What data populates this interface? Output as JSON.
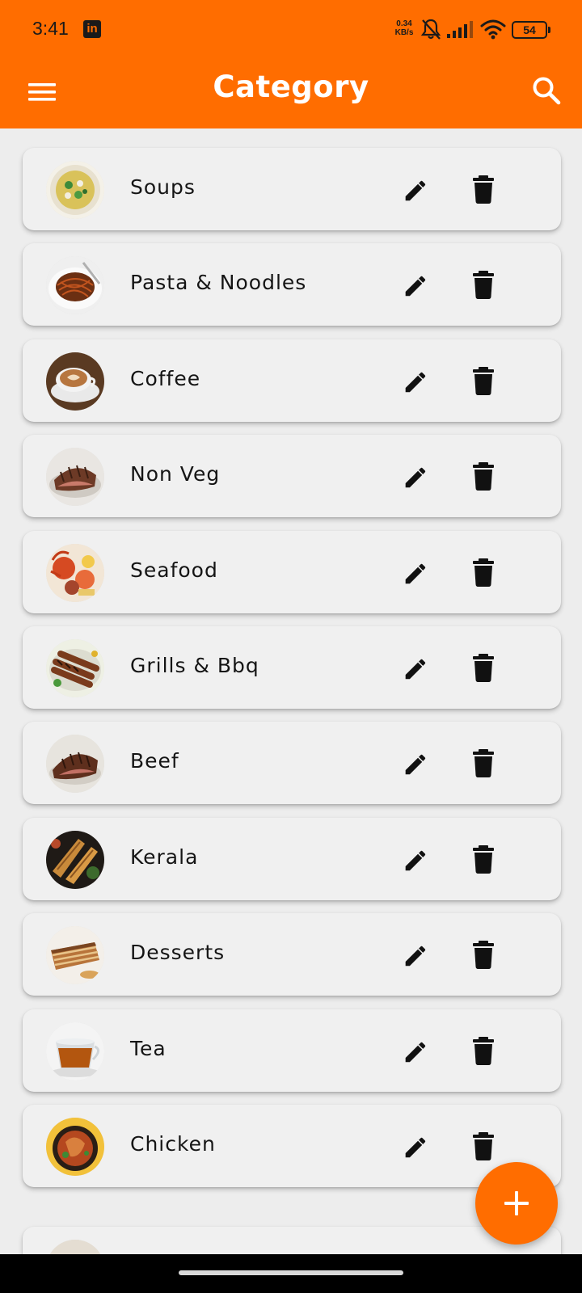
{
  "status_bar": {
    "time": "3:41",
    "notification_icon": "linkedin-icon",
    "net_speed_value": "0.34",
    "net_speed_unit": "KB/s",
    "battery": "54"
  },
  "app_bar": {
    "title": "Category",
    "menu_icon": "menu-icon",
    "search_icon": "search-icon"
  },
  "categories": [
    {
      "label": "Soups",
      "image": "soups-thumbnail"
    },
    {
      "label": "Pasta & Noodles",
      "image": "pasta-thumbnail"
    },
    {
      "label": "Coffee",
      "image": "coffee-thumbnail"
    },
    {
      "label": "Non Veg",
      "image": "non-veg-thumbnail"
    },
    {
      "label": "Seafood",
      "image": "seafood-thumbnail"
    },
    {
      "label": "Grills & Bbq",
      "image": "grills-thumbnail"
    },
    {
      "label": "Beef",
      "image": "beef-thumbnail"
    },
    {
      "label": "Kerala",
      "image": "kerala-thumbnail"
    },
    {
      "label": "Desserts",
      "image": "desserts-thumbnail"
    },
    {
      "label": "Tea",
      "image": "tea-thumbnail"
    },
    {
      "label": "Chicken",
      "image": "chicken-thumbnail"
    }
  ],
  "item_actions": {
    "edit_icon": "pencil-icon",
    "delete_icon": "trash-icon"
  },
  "fab": {
    "icon": "plus-icon"
  },
  "colors": {
    "accent": "#ff6d00",
    "card": "#f0f0f0",
    "background": "#ededed",
    "text": "#151515"
  }
}
